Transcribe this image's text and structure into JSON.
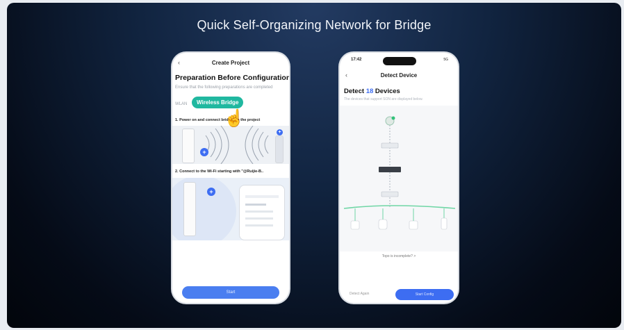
{
  "slide_title": "Quick Self-Organizing Network for Bridge",
  "phone1": {
    "nav_title": "Create Project",
    "heading": "Preparation Before Configuration",
    "subtitle": "Ensure that the following preparations are completed",
    "tab_wlan": "WLAN",
    "tab_bridge": "Wireless Bridge",
    "step1": "1. Power on and connect bridges in the project",
    "step2": "2. Connect to the Wi-Fi starting with \"@Ruijie-B..",
    "start_button": "Start"
  },
  "phone2": {
    "status_time": "17:42",
    "status_right": "5G",
    "nav_title": "Detect Device",
    "detect_prefix": "Detect",
    "detect_count": "18",
    "detect_suffix": "Devices",
    "detect_subtitle": "The devices that support SON are displayed below.",
    "topology_incomplete": "Topo is incomplete? >",
    "detect_again": "Detect Again",
    "start_config": "Start Config"
  },
  "colors": {
    "accent_blue": "#3d6df2",
    "bridge_tab": "#20b8a0",
    "topology_line": "#6fd6a5"
  },
  "icons": [
    "back-chevron-icon",
    "hand-pointer-icon",
    "plus-icon",
    "wifi-signal-icon"
  ]
}
